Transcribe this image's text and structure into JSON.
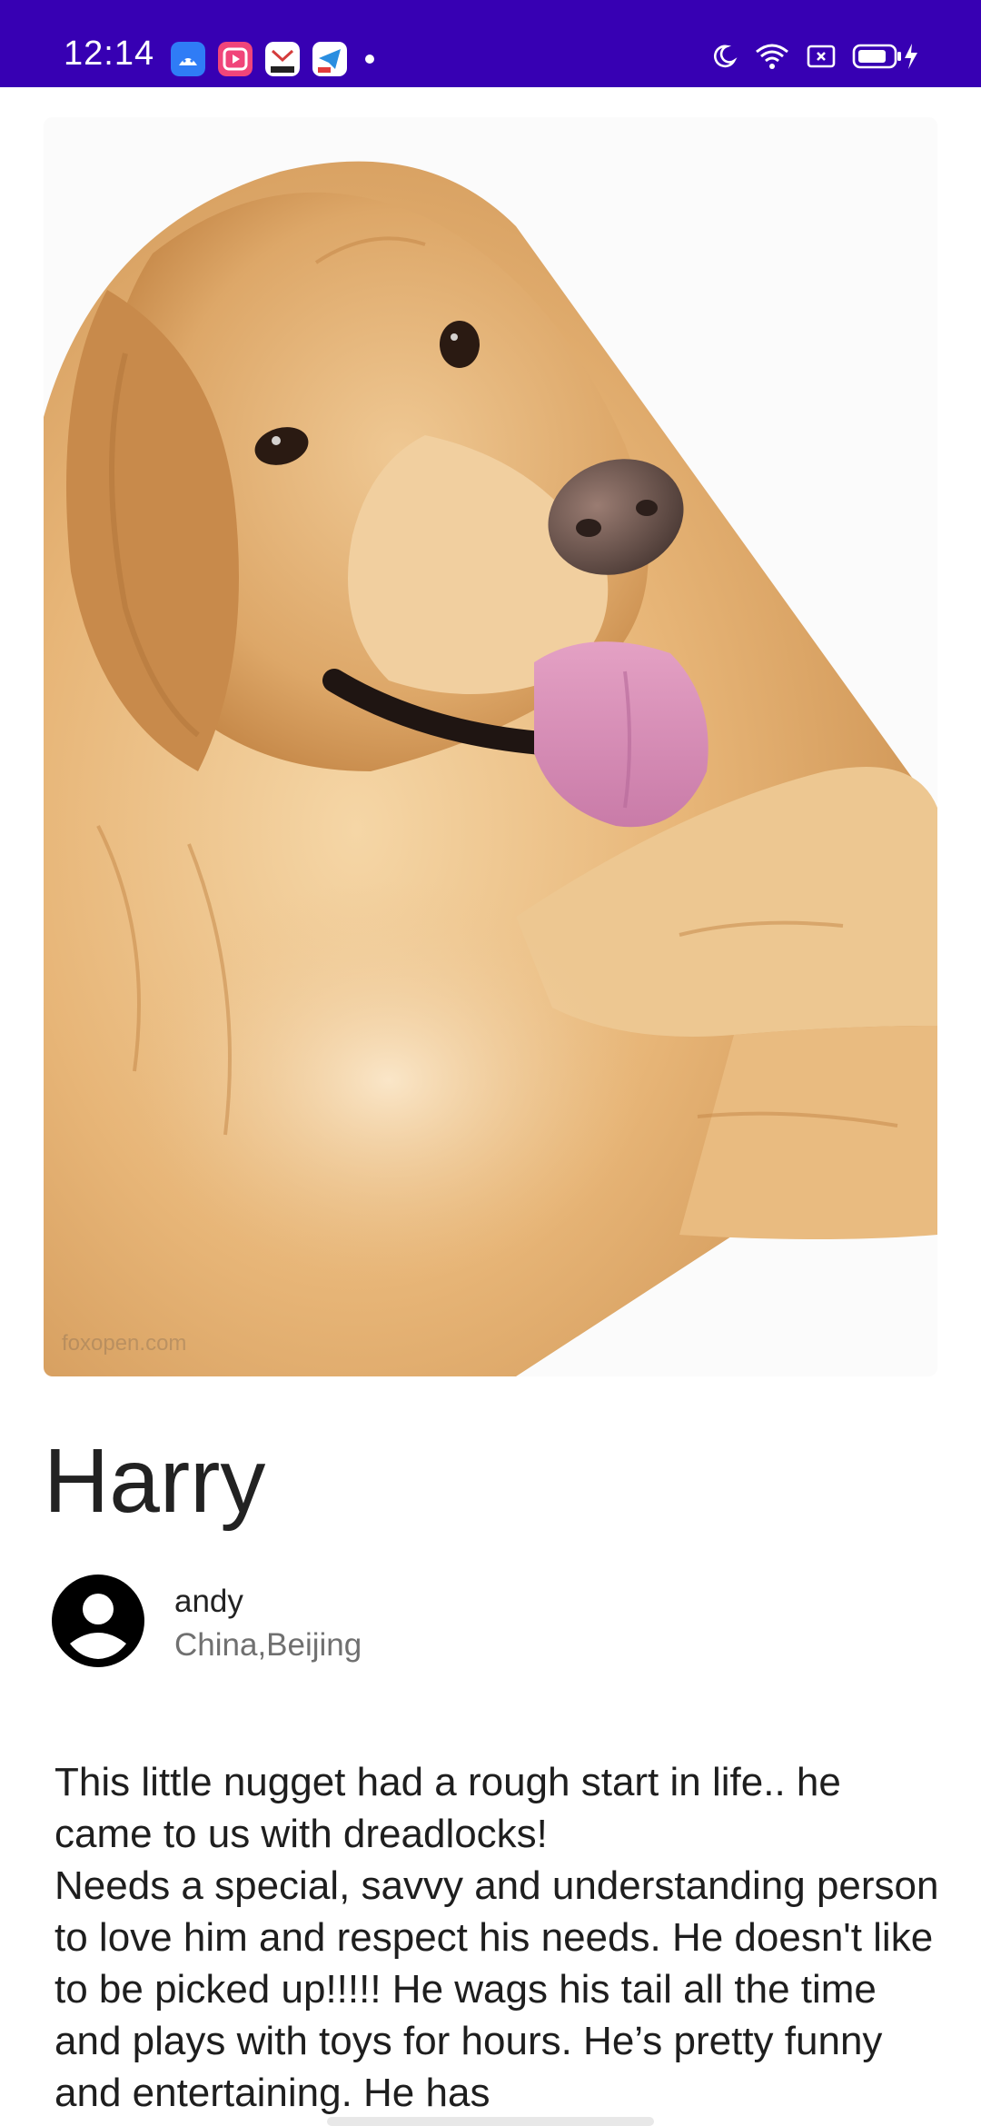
{
  "status_bar": {
    "time": "12:14",
    "background": "#3700b3",
    "notification_icons": [
      "android-app-icon",
      "video-app-icon",
      "mail-app-icon",
      "telegram-app-icon"
    ],
    "system_icons": [
      "moon-icon",
      "wifi-icon",
      "sim-icon",
      "battery-charging-icon"
    ]
  },
  "pet": {
    "image_icon": "golden-retriever-photo",
    "watermark": "foxopen.com",
    "name": "Harry"
  },
  "owner": {
    "name": "andy",
    "location": "China,Beijing"
  },
  "description": "This little nugget had a rough start in life.. he came to us with dreadlocks!\nNeeds a special, savvy and understanding person to love him and respect his needs. He doesn't like to be picked up!!!!! He wags his tail all the time and plays with toys for hours. He’s pretty funny and entertaining. He has"
}
